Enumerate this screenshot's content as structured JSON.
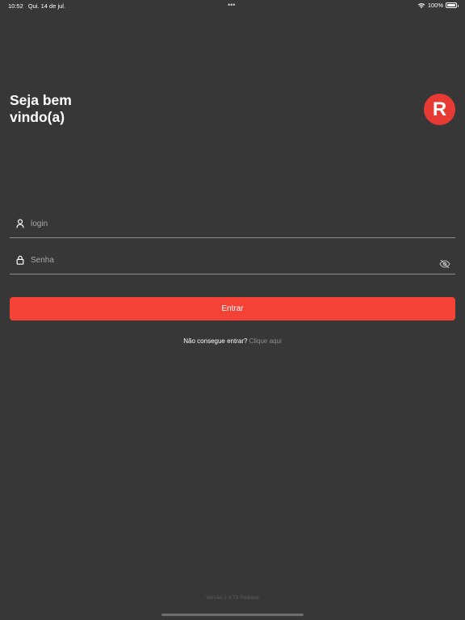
{
  "status_bar": {
    "time": "10:52",
    "date": "Qui. 14 de jul.",
    "dots": "•••",
    "battery_text": "100%",
    "battery_level": 1.0
  },
  "header": {
    "welcome_line1": "Seja bem",
    "welcome_line2": "vindo(a)",
    "logo_letter": "R",
    "logo_color": "#e83a34"
  },
  "form": {
    "login": {
      "placeholder": "login",
      "value": ""
    },
    "password": {
      "placeholder": "Senha",
      "value": ""
    },
    "submit_label": "Entrar",
    "button_color": "#f44336"
  },
  "help": {
    "text": "Não consegue entrar?",
    "link": "Clique aqui"
  },
  "footer": {
    "version": "Versão 2.4.73 Release"
  },
  "icons": {
    "login_field": "user-icon",
    "password_field": "lock-icon",
    "password_toggle": "eye-off-icon",
    "wifi": "wifi-icon",
    "battery": "battery-icon"
  },
  "colors": {
    "background": "#373737",
    "divider": "#8e8e8e"
  }
}
